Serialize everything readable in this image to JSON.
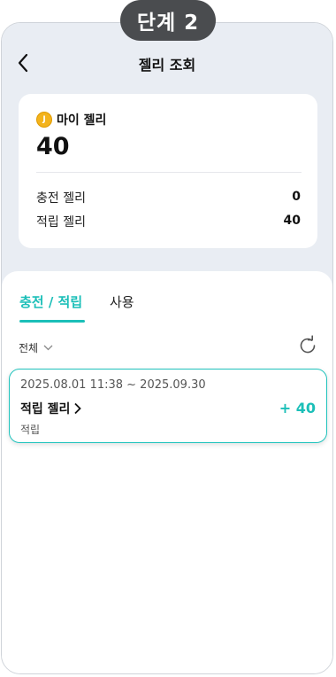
{
  "step_badge": "단계 2",
  "header": {
    "title": "젤리 조회",
    "back_icon": "chevron-left-icon"
  },
  "summary": {
    "my_jelly_label": "마이 젤리",
    "coin_icon_letter": "J",
    "total": "40",
    "rows": [
      {
        "label": "충전 젤리",
        "value": "0"
      },
      {
        "label": "적립 젤리",
        "value": "40"
      }
    ]
  },
  "tabs": [
    {
      "label": "충전 / 적립",
      "active": true
    },
    {
      "label": "사용",
      "active": false
    }
  ],
  "filter": {
    "selected": "전체"
  },
  "history": [
    {
      "period": "2025.08.01 11:38 ~ 2025.09.30",
      "title": "적립 젤리",
      "amount": "+ 40",
      "type": "적립"
    }
  ],
  "colors": {
    "accent": "#1bbfb8",
    "top_background": "#e9edf3",
    "badge_background": "#4a4c4f",
    "coin": "#f3b31d"
  }
}
